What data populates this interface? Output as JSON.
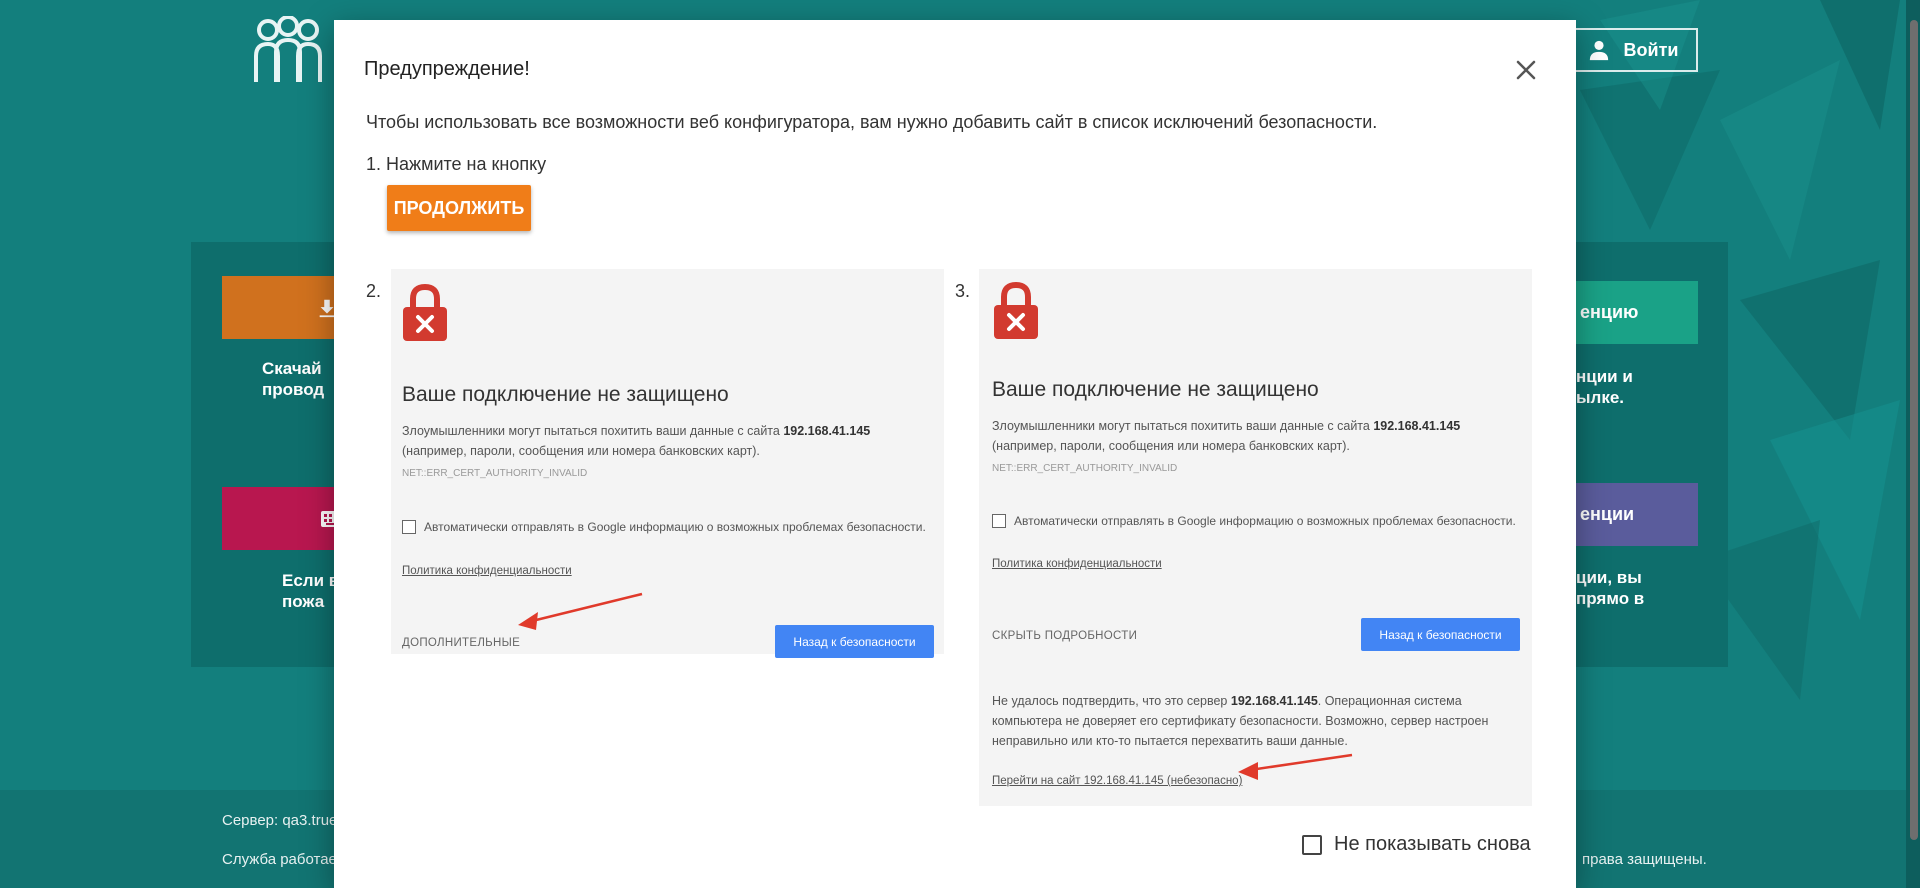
{
  "background": {
    "login_label": "Войти",
    "card_top_left_text": [
      "Скачай",
      "провод"
    ],
    "card_bottom_left_text": [
      "Если в",
      "пожа"
    ],
    "card_top_right_label": "енцию",
    "card_top_right_text": [
      "нции и",
      "ылке."
    ],
    "card_bottom_right_label": "енции",
    "card_bottom_right_text": [
      "ции, вы",
      "прямо в"
    ],
    "footer_server": "Сервер: qa3.true",
    "footer_service": "Служба работае",
    "footer_rights": "права защищены.",
    "colors": {
      "orange_card": "#d0711e",
      "green_card": "#1aa287",
      "pink_card": "#b8174f",
      "purple_card": "#5a5c9c"
    }
  },
  "modal": {
    "title": "Предупреждение!",
    "intro": "Чтобы использовать все возможности веб конфигуратора, вам нужно добавить сайт в список исключений безопасности.",
    "step1_label": "1. Нажмите на кнопку",
    "continue_label": "ПРОДОЛЖИТЬ",
    "step2_number": "2.",
    "step3_number": "3.",
    "dont_show_label": "Не показывать снова",
    "accent": "#f07d18"
  },
  "warning_shots": {
    "title": "Ваше подключение не защищено",
    "desc_prefix": "Злоумышленники могут пытаться похитить ваши данные с сайта",
    "host": "192.168.41.145",
    "desc_suffix": "(например, пароли, сообщения или номера банковских карт).",
    "error_code": "NET::ERR_CERT_AUTHORITY_INVALID",
    "report_checkbox": "Автоматически отправлять в Google информацию о возможных проблемах безопасности.",
    "privacy_link": "Политика конфиденциальности",
    "advanced_label": "ДОПОЛНИТЕЛЬНЫЕ",
    "hide_details_label": "СКРЫТЬ ПОДРОБНОСТИ",
    "back_label": "Назад к безопасности",
    "details_prefix": "Не удалось подтвердить, что это сервер",
    "details_suffix_1": ". Операционная система",
    "details_line2": "компьютера не доверяет его сертификату безопасности. Возможно, сервер настроен",
    "details_line3": "неправильно или кто-то пытается перехватить ваши данные.",
    "proceed_link": "Перейти на сайт 192.168.41.145 (небезопасно)"
  }
}
